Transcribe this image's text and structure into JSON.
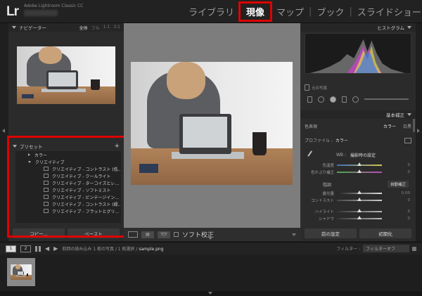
{
  "header": {
    "logo": "Lr",
    "app_name": "Adobe Lightroom Classic CC",
    "modules": [
      "ライブラリ",
      "現像",
      "マップ",
      "ブック",
      "スライドショー"
    ],
    "more": "»",
    "active_module": "現像"
  },
  "left_panel": {
    "navigator": {
      "title": "ナビゲーター",
      "zoom_options": [
        "全体",
        "フル",
        "1:1",
        "3:1"
      ],
      "selected_zoom": "全体"
    },
    "presets": {
      "title": "プリセット",
      "add": "+",
      "folders": [
        {
          "name": "カラー",
          "expanded": false
        },
        {
          "name": "クリエイティブ",
          "expanded": true
        }
      ],
      "items": [
        "クリエイティブ - コントラスト (低…",
        "クリエイティブ - クールライト",
        "クリエイティブ - ターコイズとレ…",
        "クリエイティブ - ソフトミスト",
        "クリエイティブ - ビンテージイン…",
        "クリエイティブ - コントラスト (緑…",
        "クリエイティブ - フラットとグリ…"
      ]
    },
    "buttons": [
      "コピー...",
      "ペースト"
    ]
  },
  "center_toolbar": {
    "icon_box_a": "▤",
    "icon_box_b": "Y|Y",
    "soft_proof_label": "ソフト校正"
  },
  "right_panel": {
    "histogram_title": "ヒストグラム",
    "original_photo": "元の写真",
    "basic_title": "基本補正",
    "treatment": {
      "label": "色表現",
      "options": [
        "カラー",
        "白黒"
      ],
      "selected": "カラー"
    },
    "profile": {
      "label": "プロファイル :",
      "value": "カラー"
    },
    "wb": {
      "label": "WB :",
      "value": "撮影時の設定"
    },
    "wb_sliders": [
      {
        "label": "色温度",
        "value": "0"
      },
      {
        "label": "色かぶり補正",
        "value": "0"
      }
    ],
    "tone": {
      "label": "階調",
      "auto": "自動補正"
    },
    "tone_sliders": [
      {
        "label": "露光量",
        "value": "0.00"
      },
      {
        "label": "コントラスト",
        "value": "0"
      },
      {
        "label": "ハイライト",
        "value": "0"
      },
      {
        "label": "シャドウ",
        "value": "0"
      }
    ],
    "buttons": [
      "前の設定",
      "初期化"
    ]
  },
  "filmstrip": {
    "screen1": "1",
    "screen2": "2",
    "path_prefix": "前回の読み込み  1 枚の写真 / 1 枚選択 /",
    "filename": "sample.png",
    "filter_label": "フィルター :",
    "filter_value": "フィルターオフ"
  },
  "colors": {
    "highlight_red": "#e00000",
    "panel_bg": "#2b2b2b",
    "center_bg": "#7d7d7d"
  }
}
